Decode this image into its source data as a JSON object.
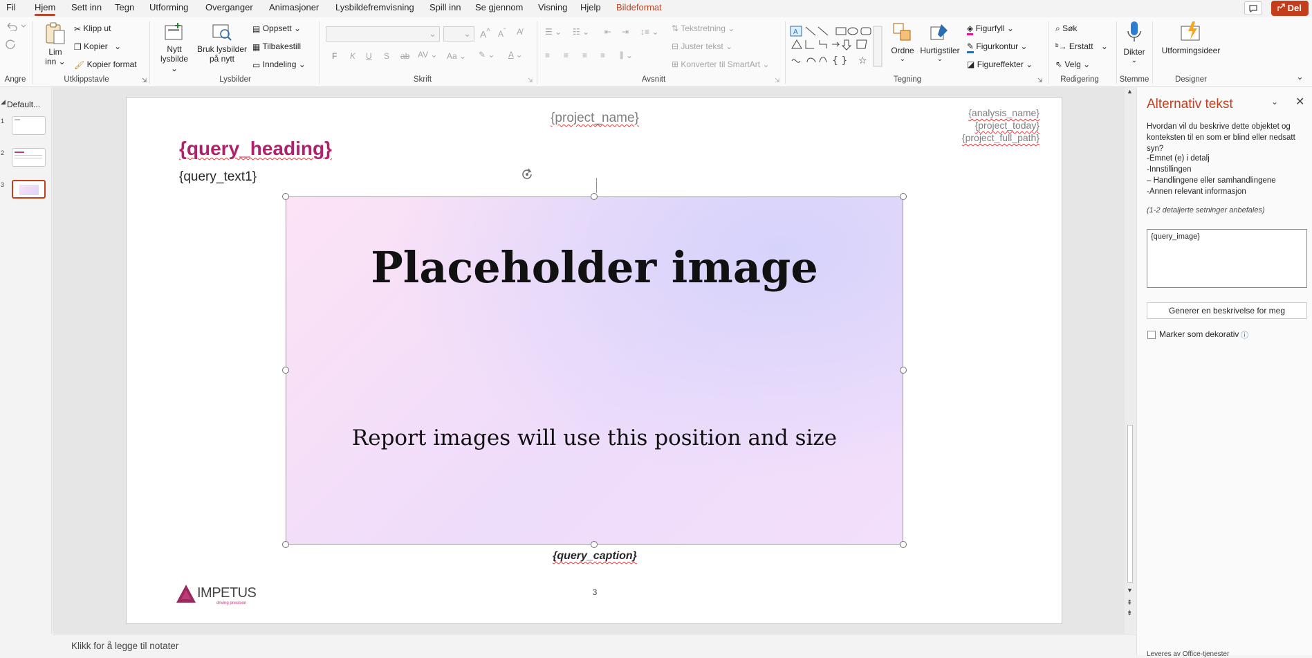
{
  "menu": {
    "tabs": [
      "Fil",
      "Hjem",
      "Sett inn",
      "Tegn",
      "Utforming",
      "Overganger",
      "Animasjoner",
      "Lysbildefremvisning",
      "Spill inn",
      "Se gjennom",
      "Visning",
      "Hjelp",
      "Bildeformat"
    ],
    "active_tab": "Hjem",
    "share_label": "Del"
  },
  "ribbon": {
    "groups": {
      "angre": "Angre",
      "utklipp": "Utklippstavle",
      "lysbilder": "Lysbilder",
      "skrift": "Skrift",
      "avsnitt": "Avsnitt",
      "tegning": "Tegning",
      "redigering": "Redigering",
      "stemme": "Stemme",
      "designer": "Designer"
    },
    "clipboard": {
      "paste_line1": "Lim",
      "paste_line2": "inn",
      "cut": "Klipp ut",
      "copy": "Kopier",
      "format_painter": "Kopier format"
    },
    "slides": {
      "new_line1": "Nytt",
      "new_line2": "lysbilde",
      "reuse_line1": "Bruk lysbilder",
      "reuse_line2": "på nytt",
      "layout": "Oppsett",
      "reset": "Tilbakestill",
      "section": "Inndeling"
    },
    "font": {
      "bold": "F",
      "italic": "K",
      "underline": "U",
      "shadow": "S",
      "strike": "ab",
      "spacing": "AV",
      "case": "Aa"
    },
    "paragraph": {
      "text_direction": "Tekstretning",
      "align_text": "Juster tekst",
      "smartart": "Konverter til SmartArt"
    },
    "drawing": {
      "arrange": "Ordne",
      "quick_styles": "Hurtigstiler",
      "fill": "Figurfyll",
      "outline": "Figurkontur",
      "effects": "Figureffekter"
    },
    "editing": {
      "find": "Søk",
      "replace": "Erstatt",
      "select": "Velg"
    },
    "voice": {
      "dictate": "Dikter"
    },
    "designer": {
      "ideas": "Utformingsideer"
    }
  },
  "slides_panel": {
    "section_name": "Default...",
    "slides": [
      {
        "number": "1"
      },
      {
        "number": "2"
      },
      {
        "number": "3"
      }
    ]
  },
  "slide": {
    "project_name": "{project_name}",
    "analysis_name": "{analysis_name}",
    "project_today": "{project_today}",
    "project_full_path": "{project_full_path}",
    "query_heading": "{query_heading}",
    "query_text1": "{query_text1}",
    "image_title": "Placeholder image",
    "image_subtitle": "Report images will use this position and size",
    "query_caption": "{query_caption}",
    "logo_text": "IMPETUS",
    "logo_tagline": "driving precision",
    "page_number": "3"
  },
  "alt_text_pane": {
    "title": "Alternativ tekst",
    "description": "Hvordan vil du beskrive dette objektet og konteksten til en som er blind eller nedsatt syn?",
    "bullets": [
      "-Emnet (e) i detalj",
      "-Innstillingen",
      "– Handlingene eller samhandlingene",
      "-Annen relevant informasjon"
    ],
    "hint": "(1-2 detaljerte setninger anbefales)",
    "textarea_value": "{query_image}",
    "generate_button": "Generer en beskrivelse for meg",
    "decorative_label": "Marker som dekorativ",
    "footer": "Leveres av Office-tjenester"
  },
  "notes": {
    "placeholder": "Klikk for å legge til notater"
  },
  "colors": {
    "accent": "#b7472a",
    "heading": "#b0226b",
    "logo": "#9b2a5c"
  }
}
